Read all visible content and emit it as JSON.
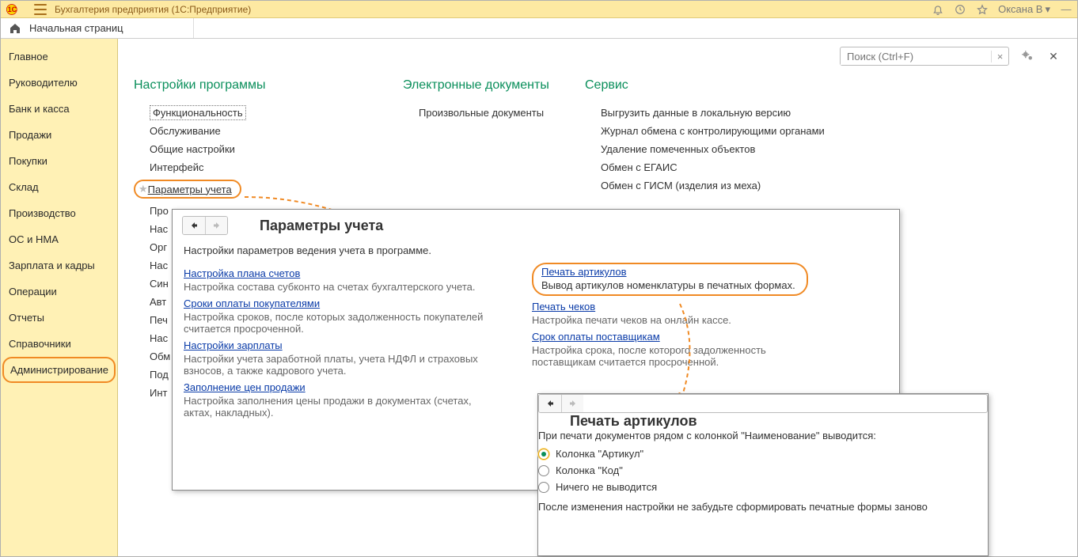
{
  "titlebar": {
    "app_title": "Бухгалтерия предприятия  (1С:Предприятие)",
    "user": "Оксана В"
  },
  "breadcrumb": {
    "start": "Начальная страниц"
  },
  "search": {
    "placeholder": "Поиск (Ctrl+F)",
    "clear": "×"
  },
  "sidebar": [
    "Главное",
    "Руководителю",
    "Банк и касса",
    "Продажи",
    "Покупки",
    "Склад",
    "Производство",
    "ОС и НМА",
    "Зарплата и кадры",
    "Операции",
    "Отчеты",
    "Справочники",
    "Администрирование"
  ],
  "sections": {
    "s1": "Настройки программы",
    "s2": "Электронные документы",
    "s3": "Сервис"
  },
  "col1": {
    "i0": "Функциональность",
    "i1": "Обслуживание",
    "i2": "Общие настройки",
    "i3": "Интерфейс",
    "i4": "Параметры учета",
    "i5": "Про",
    "i6": "Нас",
    "i7": "Орг",
    "i8": "Нас",
    "i9": "Син",
    "i10": "Авт",
    "i11": "Печ",
    "i12": "Нас",
    "i13": "Обм",
    "i14": "Под",
    "i15": "Инт"
  },
  "col2": {
    "i0": "Произвольные документы"
  },
  "col3": {
    "i0": "Выгрузить данные в локальную версию",
    "i1": "Журнал обмена с контролирующими органами",
    "i2": "Удаление помеченных объектов",
    "i3": "Обмен с ЕГАИС",
    "i4": "Обмен с ГИСМ (изделия из меха)"
  },
  "popup1": {
    "title": "Параметры учета",
    "desc": "Настройки параметров ведения учета в программе.",
    "l1": "Настройка плана счетов",
    "l1d": "Настройка состава субконто на счетах бухгалтерского учета.",
    "l2": "Сроки оплаты покупателями",
    "l2d": "Настройка сроков, после которых задолженность покупателей считается просроченной.",
    "l3": "Настройки зарплаты",
    "l3d": "Настройки учета заработной платы, учета НДФЛ и страховых взносов, а также кадрового учета.",
    "l4": "Заполнение цен продажи",
    "l4d": "Настройка заполнения цены продажи в документах (счетах, актах, накладных).",
    "r1": "Печать артикулов",
    "r1d": "Вывод артикулов номенклатуры в печатных формах.",
    "r2": "Печать чеков",
    "r2d": "Настройка печати чеков на онлайн кассе.",
    "r3": "Срок оплаты поставщикам",
    "r3d": "Настройка срока, после которого задолженность поставщикам считается просроченной."
  },
  "popup2": {
    "title": "Печать артикулов",
    "intro": "При печати документов рядом с колонкой \"Наименование\" выводится:",
    "opt1": "Колонка \"Артикул\"",
    "opt2": "Колонка \"Код\"",
    "opt3": "Ничего не выводится",
    "note": "После изменения настройки не забудьте сформировать печатные формы заново"
  }
}
